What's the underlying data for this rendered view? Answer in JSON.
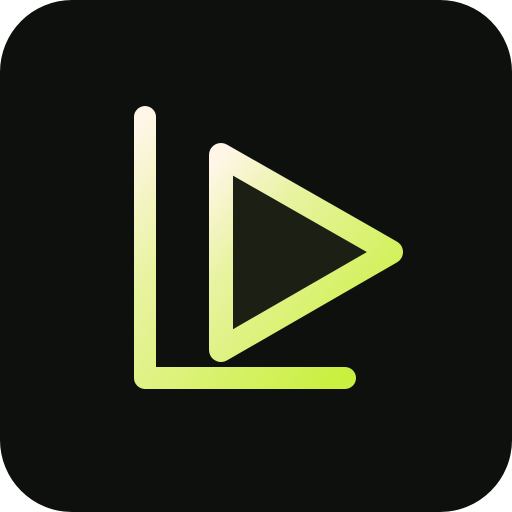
{
  "app_icon": {
    "icon_name": "play-logo-icon",
    "colors": {
      "background": "#0E100D",
      "stroke_start": "#FFF6E8",
      "stroke_end": "#C9F03E",
      "triangle_fill": "#1C1F14"
    }
  }
}
